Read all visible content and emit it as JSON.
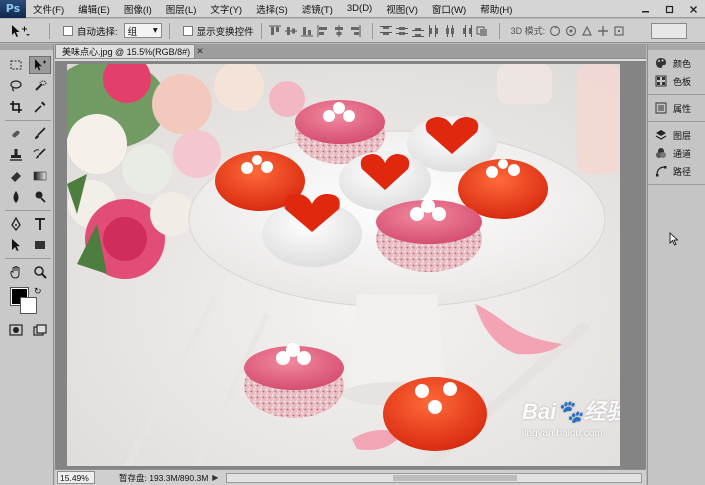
{
  "app": {
    "logo": "Ps",
    "menu": [
      "文件(F)",
      "编辑(E)",
      "图像(I)",
      "图层(L)",
      "文字(Y)",
      "选择(S)",
      "滤镜(T)",
      "3D(D)",
      "视图(V)",
      "窗口(W)",
      "帮助(H)"
    ],
    "window_controls": [
      "minimize",
      "restore",
      "close"
    ]
  },
  "options_bar": {
    "auto_select_label": "自动选择:",
    "auto_select_value": "组",
    "show_transform_label": "显示变换控件",
    "mode3d_label": "3D 模式:"
  },
  "document": {
    "tab_title": "美味点心.jpg @ 15.5%(RGB/8#)",
    "zoom": "15.49%",
    "doc_info": "暂存盘: 193.3M/890.3M"
  },
  "panels": {
    "group1": [
      {
        "icon": "swatch-palette-icon",
        "label": "颜色"
      },
      {
        "icon": "swatches-grid-icon",
        "label": "色板"
      }
    ],
    "group2": [
      {
        "icon": "properties-icon",
        "label": "属性"
      }
    ],
    "group3": [
      {
        "icon": "layers-icon",
        "label": "图层"
      },
      {
        "icon": "channels-icon",
        "label": "通道"
      },
      {
        "icon": "paths-icon",
        "label": "路径"
      }
    ]
  },
  "watermark": {
    "logo": "Bai🐾经验",
    "url": "jingyan.baidu.com"
  },
  "colors": {
    "foreground": "#000000",
    "background": "#ffffff"
  }
}
